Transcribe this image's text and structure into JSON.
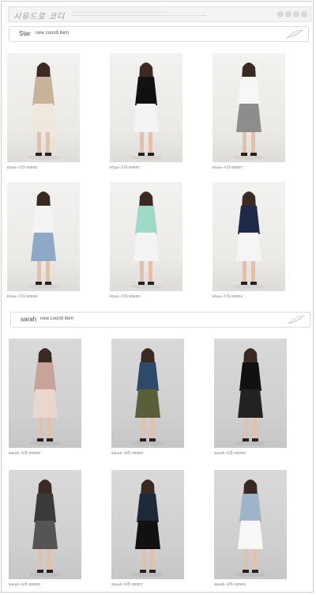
{
  "site": {
    "logo_text": "시유드로 코디",
    "header_text": "────────────────────────────────────"
  },
  "sections": [
    {
      "name": "Star",
      "subtitle": "new coordi item",
      "products": [
        {
          "code": "Khao-스타-00000",
          "outfit": "beige long skirt, white knit top"
        },
        {
          "code": "Khao-스타-00007",
          "outfit": "black mini dress, white blazer"
        },
        {
          "code": "Khao-스타-00007",
          "outfit": "white jeans, grey jacket"
        },
        {
          "code": "Khao-스타-00000",
          "outfit": "white mini skirt, denim jacket"
        },
        {
          "code": "Khao-스타-00000",
          "outfit": "mint long coat, white dress"
        },
        {
          "code": "Khao-스타-00004",
          "outfit": "navy dress, white top"
        }
      ]
    },
    {
      "name": "sarah",
      "subtitle": "new coordi item",
      "products": [
        {
          "code": "Sarah-사라-00000",
          "outfit": "blush pleated dress"
        },
        {
          "code": "Sarah-사라-00000",
          "outfit": "khaki jacket, skinny jeans"
        },
        {
          "code": "Sarah-사라-00000",
          "outfit": "black cardigan, black skirt"
        },
        {
          "code": "Sarah-사라-00000",
          "outfit": "dark printed dress"
        },
        {
          "code": "Sarah-사라-00007",
          "outfit": "black jacket, floral skirt"
        },
        {
          "code": "Sarah-사라-00000",
          "outfit": "white blouse, denim skirt"
        }
      ]
    }
  ],
  "colors": {
    "accent": "#b8b8b8"
  }
}
